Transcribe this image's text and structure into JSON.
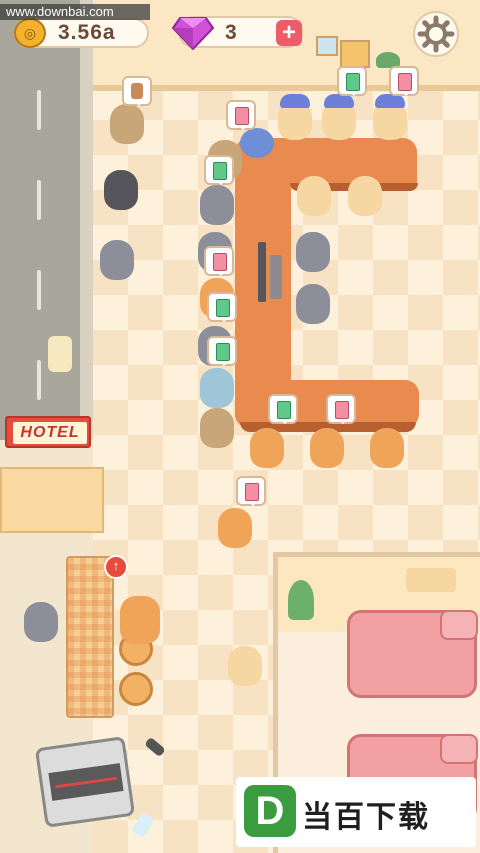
{
  "hud": {
    "watermark": "www.downbai.com",
    "coins": "3.56a",
    "coin_icon": "coin-icon",
    "gems": "3",
    "gem_icon": "gem-icon",
    "add_gems_label": "+",
    "settings_icon": "gear-icon"
  },
  "signs": {
    "hotel": "HOTEL"
  },
  "dining": {
    "upgrade_label": "↑"
  },
  "branding": {
    "logo_letter": "D",
    "logo_text": "当百下载"
  },
  "colors": {
    "counter": "#e98a4e",
    "floor": "#fdf1dc",
    "bed": "#f2a0a2",
    "gem": "#d24fd6"
  }
}
